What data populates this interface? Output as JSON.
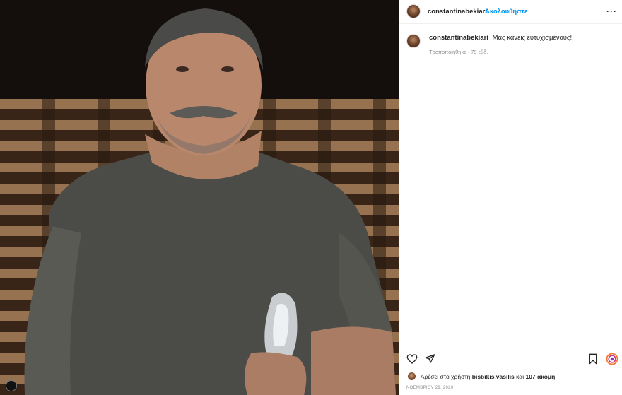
{
  "post": {
    "author": "constantinabekiari",
    "follow_label": "Ακολουθήστε",
    "separator": "•",
    "more_label": "···"
  },
  "caption": {
    "username": "constantinabekiari",
    "text": "Μας κάνεις ευτυχισμένους!",
    "meta": "Τροποποιήθηκε · 79 εβδ."
  },
  "actions": {
    "likes_prefix": "Αρέσει στο χρήστη",
    "liked_by": "bisbikis.vasilis",
    "likes_joiner": "και",
    "others": "107 ακόμη",
    "date": "ΝΟΕΜΒΡΙΟΥ 29, 2020"
  },
  "colors": {
    "accent": "#0095f6",
    "text": "#262626",
    "muted": "#8e8e8e"
  },
  "icons": [
    "heart-icon",
    "share-icon",
    "bookmark-icon",
    "igtv-icon",
    "more-icon"
  ]
}
